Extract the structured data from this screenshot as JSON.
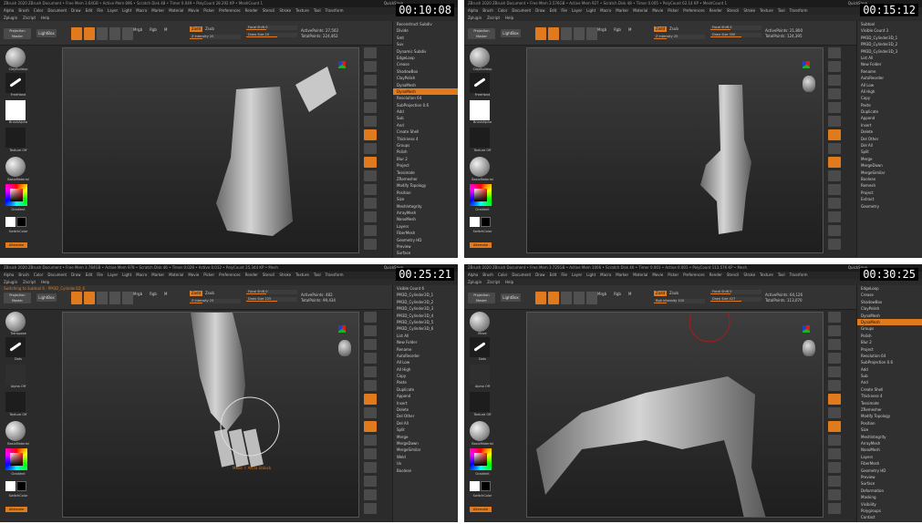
{
  "quads": [
    {
      "id": "q1",
      "timestamp": "00:10:08",
      "titlebar": "ZBrush 2020  ZBrush Document  • Free Mem 3.64GB • Active Mem 896 • Scratch Disk 48 • Timer 0.049 • PolyCount 28.292 KP • MeshCount 1",
      "quicksave": "QuickSave",
      "menu": [
        "Alpha",
        "Brush",
        "Color",
        "Document",
        "Draw",
        "Edit",
        "File",
        "Layer",
        "Light",
        "Macro",
        "Marker",
        "Material",
        "Movie",
        "Picker",
        "Preferences",
        "Render",
        "Stencil",
        "Stroke",
        "Texture",
        "Tool",
        "Transform"
      ],
      "submenu": [
        "Zplugin",
        "Zscript",
        "Help"
      ],
      "projection": "Projection Master",
      "lightbox": "LightBox",
      "modes": [
        "Mrgb",
        "Rgb",
        "M"
      ],
      "zadd": "Zadd",
      "zsub": "Zsub",
      "slider1": "Focal Shift 0",
      "slider2": "Draw Size 20",
      "slider3": "Z Intensity 25",
      "stats": [
        "ActivePoints: 27,502",
        "TotalPoints: 224,462"
      ],
      "left_labels": [
        "ClayBuildup",
        "FreeHand",
        "BrushAlpha",
        "Texture Off",
        "BasicMaterial",
        "Gradient",
        "SwitchColor",
        "Alternate"
      ],
      "panel": [
        "Reconstruct Subdiv",
        "Divide",
        "Smt",
        "Suv",
        "Dynamic Subdiv",
        "EdgeLoop",
        "Crease",
        "ShadowBox",
        "ClayPolish",
        "DynaMesh",
        "DynaMesh",
        "Resolution 64",
        "SubProjection 0.6",
        "Add",
        "Sub",
        "And",
        "Create Shell",
        "Thickness 4",
        "Groups",
        "Polish",
        "Blur 2",
        "Project",
        "Tessimate",
        "ZRemesher",
        "Modify Topology",
        "Position",
        "Size",
        "MeshIntegrity",
        "ArrayMesh",
        "NanoMesh",
        "Layers",
        "FiberMesh",
        "Geometry HD",
        "Preview",
        "Surface",
        "Deformation",
        "Masking",
        "Visibility"
      ]
    },
    {
      "id": "q2",
      "timestamp": "00:15:12",
      "titlebar": "ZBrush 2020  ZBrush Document  • Free Mem 3.576GB • Active Mem 927 • Scratch Disk 48 • Timer 0.005 • PolyCount 62.14 KP • MeshCount 1",
      "quicksave": "QuickSave",
      "menu": [
        "Alpha",
        "Brush",
        "Color",
        "Document",
        "Draw",
        "Edit",
        "File",
        "Layer",
        "Light",
        "Macro",
        "Marker",
        "Material",
        "Movie",
        "Picker",
        "Preferences",
        "Render",
        "Stencil",
        "Stroke",
        "Texture",
        "Tool",
        "Transform"
      ],
      "submenu": [
        "Zplugin",
        "Zscript",
        "Help"
      ],
      "projection": "Projection Master",
      "lightbox": "LightBox",
      "modes": [
        "Mrgb",
        "Rgb",
        "M"
      ],
      "zadd": "Zadd",
      "zsub": "Zsub",
      "slider1": "Focal Shift 0",
      "slider2": "Draw Size 300",
      "slider3": "Z Intensity 25",
      "stats": [
        "ActivePoints: 21,800",
        "TotalPoints: 124,395"
      ],
      "left_labels": [
        "ClayBuildup",
        "FreeHand",
        "BrushAlpha",
        "Texture Off",
        "BasicMaterial",
        "Gradient",
        "SwitchColor",
        "Alternate"
      ],
      "panel": [
        "Subtool",
        "Visible Count 3",
        "PM3D_Cylinder3D_1",
        "PM3D_Cylinder3D_2",
        "PM3D_Cylinder3D_3",
        "List All",
        "New Folder",
        "Rename",
        "AutoReorder",
        "All Low",
        "All High",
        "Copy",
        "Paste",
        "Duplicate",
        "Append",
        "Insert",
        "Delete",
        "Del Other",
        "Del All",
        "Split",
        "Merge",
        "MergeDown",
        "MergeSimilar",
        "Boolean",
        "Remesh",
        "Project",
        "Extract",
        "Geometry"
      ]
    },
    {
      "id": "q3",
      "timestamp": "00:25:21",
      "titlebar": "ZBrush 2020  ZBrush Document  • Free Mem 3.784GB • Active Mem 978 • Scratch Disk 46 • Timer 0.028 • Active 0.012 • PolyCount 25.344 KP • Mesh",
      "quicksave": "QuickSave",
      "menu": [
        "Alpha",
        "Brush",
        "Color",
        "Document",
        "Draw",
        "Edit",
        "File",
        "Layer",
        "Light",
        "Macro",
        "Marker",
        "Material",
        "Movie",
        "Picker",
        "Preferences",
        "Render",
        "Stencil",
        "Stroke",
        "Texture",
        "Tool",
        "Transform"
      ],
      "submenu": [
        "Zplugin",
        "Zscript",
        "Help"
      ],
      "switching": "Switching to Subtool 6 :  PM3D_Cylinder3D_6",
      "projection": "Projection Master",
      "lightbox": "LightBox",
      "modes": [
        "Mrgb",
        "Rgb",
        "M"
      ],
      "zadd": "Zadd",
      "zsub": "Zsub",
      "slider1": "Focal Shift 0",
      "slider2": "Draw Size 225",
      "slider3": "Z Intensity 25",
      "stats": [
        "ActivePoints: 482",
        "TotalPoints: 99,434"
      ],
      "left_labels": [
        "Transpose",
        "Dots",
        "Alpha Off",
        "Texture Off",
        "BasicMaterial",
        "Gradient",
        "SwitchColor",
        "Alternate"
      ],
      "hint": "Move  ⇧ Alt to Unlock",
      "panel": [
        "Visible Count 6",
        "PM3D_Cylinder3D_1",
        "PM3D_Cylinder3D_2",
        "PM3D_Cylinder3D_3",
        "PM3D_Cylinder3D_4",
        "PM3D_Cylinder3D_5",
        "PM3D_Cylinder3D_6",
        "List All",
        "New Folder",
        "Rename",
        "AutoReorder",
        "All Low",
        "All High",
        "Copy",
        "Paste",
        "Duplicate",
        "Append",
        "Insert",
        "Delete",
        "Del Other",
        "Del All",
        "Split",
        "Merge",
        "MergeDown",
        "MergeSimilar",
        "Weld",
        "Uv",
        "Boolean"
      ]
    },
    {
      "id": "q4",
      "timestamp": "00:30:25",
      "titlebar": "ZBrush 2020  ZBrush Document  • Free Mem 3.725GB • Active Mem 1006 • Scratch Disk 46 • Timer 0.001 • Active 0.001 • PolyCount 113.576 KP • Mesh",
      "quicksave": "QuickSave",
      "menu": [
        "Alpha",
        "Brush",
        "Color",
        "Document",
        "Draw",
        "Edit",
        "File",
        "Layer",
        "Light",
        "Macro",
        "Marker",
        "Material",
        "Movie",
        "Picker",
        "Preferences",
        "Render",
        "Stencil",
        "Stroke",
        "Texture",
        "Tool",
        "Transform"
      ],
      "submenu": [
        "Zplugin",
        "Zscript",
        "Help"
      ],
      "projection": "Projection Master",
      "lightbox": "LightBox",
      "modes": [
        "Mrgb",
        "Rgb",
        "M"
      ],
      "zadd": "Zadd",
      "zsub": "Zsub",
      "slider1": "Focal Shift 0",
      "slider2": "Draw Size 427",
      "slider3": "Rgb Intensity 100",
      "stats": [
        "ActivePoints: 64,126",
        "TotalPoints: 113,070"
      ],
      "left_labels": [
        "Move",
        "Dots",
        "Alpha Off",
        "Texture Off",
        "BasicMaterial",
        "Gradient",
        "SwitchColor",
        "Alternate"
      ],
      "panel": [
        "EdgeLoop",
        "Crease",
        "ShadowBox",
        "ClayPolish",
        "DynaMesh",
        "DynaMesh",
        "Groups",
        "Polish",
        "Blur 2",
        "Project",
        "Resolution 64",
        "SubProjection 0.6",
        "Add",
        "Sub",
        "And",
        "Create Shell",
        "Thickness 4",
        "Tessimate",
        "ZRemesher",
        "Modify Topology",
        "Position",
        "Size",
        "MeshIntegrity",
        "ArrayMesh",
        "NanoMesh",
        "Layers",
        "FiberMesh",
        "Geometry HD",
        "Preview",
        "Surface",
        "Deformation",
        "Masking",
        "Visibility",
        "Polygroups",
        "Contact",
        "Morph Target",
        "Polypaint"
      ]
    }
  ],
  "colors": {
    "accent": "#e07a1c",
    "bg": "#2b2b2b",
    "panel": "#303030"
  }
}
